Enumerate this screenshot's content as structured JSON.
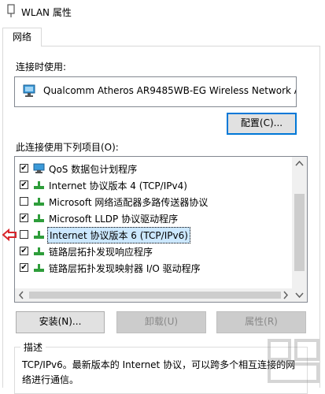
{
  "window": {
    "title": "WLAN 属性"
  },
  "tabs": [
    {
      "label": "网络"
    }
  ],
  "connect": {
    "label": "连接时使用:",
    "adapter": "Qualcomm Atheros AR9485WB-EG Wireless Network A"
  },
  "buttons": {
    "configure": "配置(C)...",
    "install": "安装(N)...",
    "uninstall": "卸载(U)",
    "properties": "属性(R)"
  },
  "items": {
    "label": "此连接使用下列项目(O):",
    "list": [
      {
        "label": "QoS 数据包计划程序",
        "checked": true,
        "icon": "qos-icon"
      },
      {
        "label": "Internet 协议版本 4 (TCP/IPv4)",
        "checked": true,
        "icon": "protocol-icon"
      },
      {
        "label": "Microsoft 网络适配器多路传送器协议",
        "checked": false,
        "icon": "protocol-icon"
      },
      {
        "label": "Microsoft LLDP 协议驱动程序",
        "checked": true,
        "icon": "protocol-icon"
      },
      {
        "label": "Internet 协议版本 6 (TCP/IPv6)",
        "checked": false,
        "icon": "protocol-icon",
        "selected": true
      },
      {
        "label": "链路层拓扑发现响应程序",
        "checked": true,
        "icon": "protocol-icon"
      },
      {
        "label": "链路层拓扑发现映射器 I/O 驱动程序",
        "checked": true,
        "icon": "protocol-icon"
      }
    ]
  },
  "description": {
    "title": "描述",
    "text": "TCP/IPv6。最新版本的 Internet 协议，可以跨多个相互连接的网络进行通信。"
  },
  "colors": {
    "accent": "#0078d7",
    "selection": "#cce8ff",
    "arrow": "#d9262c"
  }
}
